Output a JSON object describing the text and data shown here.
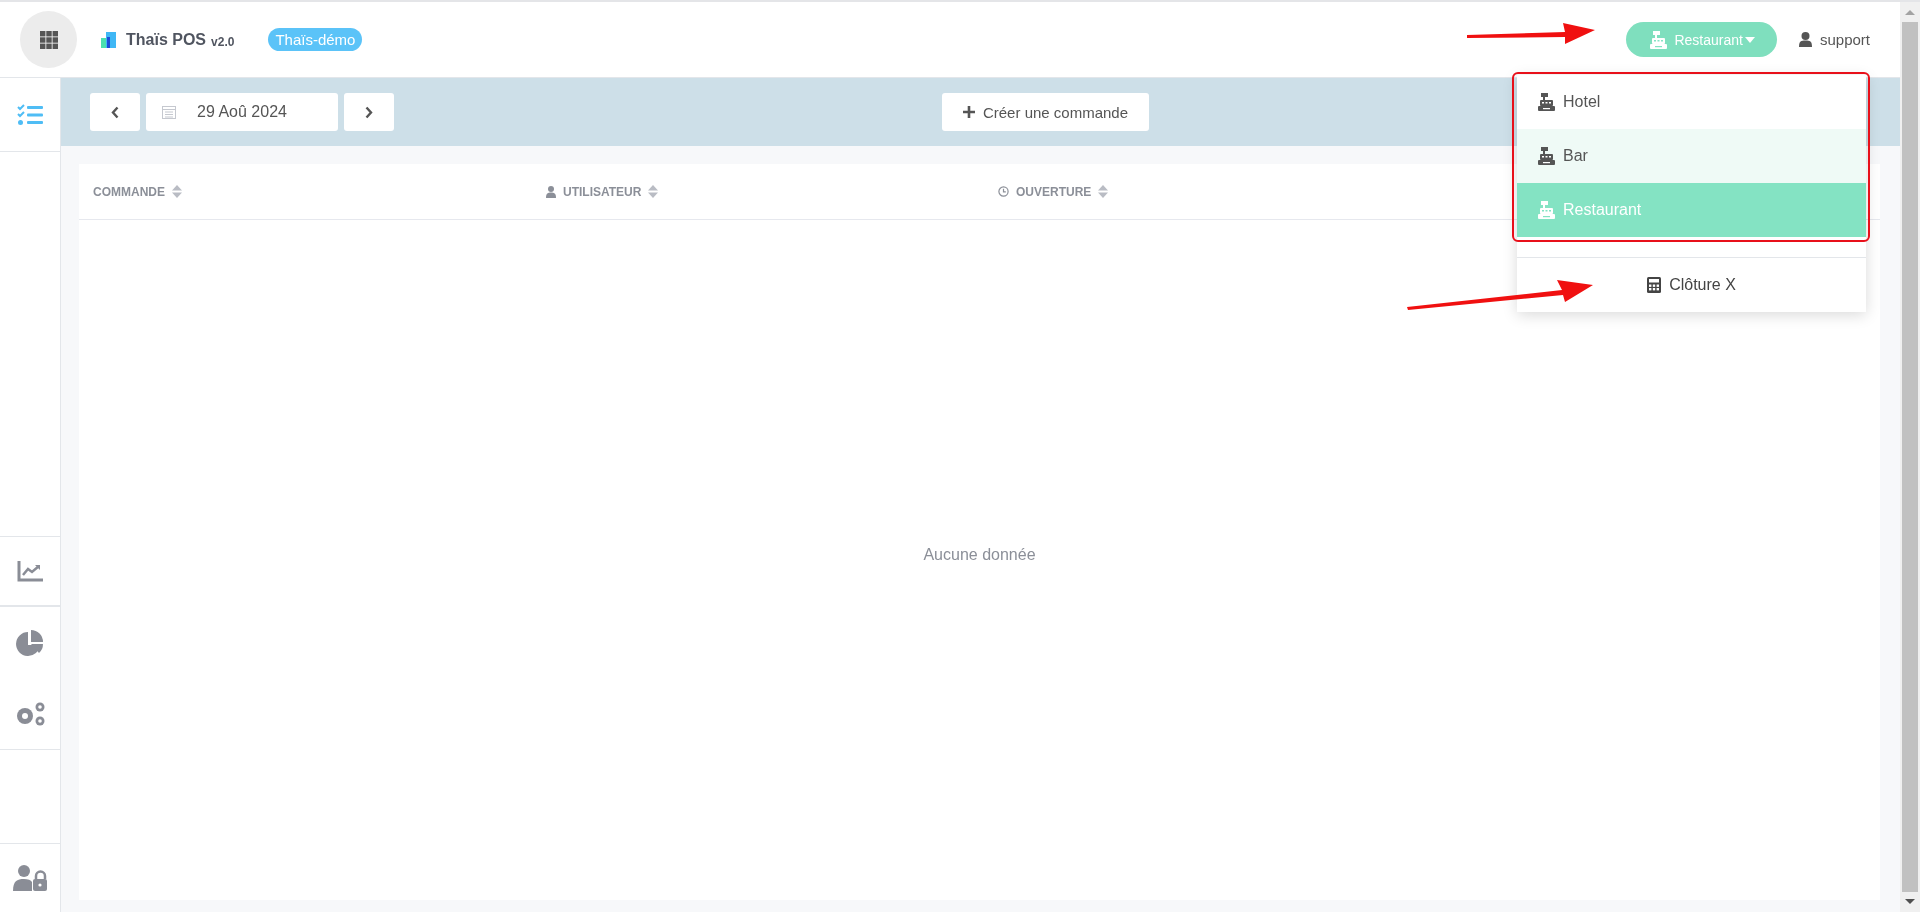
{
  "header": {
    "app_title": "Thaïs POS",
    "version": "v2.0",
    "account_badge": "Thaïs-démo",
    "site_button": {
      "label": "Restaurant",
      "expanded": true
    },
    "user": "support"
  },
  "sidebar": {
    "items": [
      {
        "selected": true
      },
      {
        "selected": false
      },
      {
        "selected": false
      },
      {
        "selected": false
      },
      {
        "selected": false
      }
    ]
  },
  "toolbar": {
    "date": "29 Aoû 2024",
    "create_button": "Créer une commande"
  },
  "table": {
    "columns": [
      "COMMANDE",
      "UTILISATEUR",
      "OUVERTURE"
    ],
    "empty_text": "Aucune donnée"
  },
  "site_menu": {
    "items": [
      {
        "label": "Hotel",
        "selected": false,
        "hovered": false
      },
      {
        "label": "Bar",
        "selected": false,
        "hovered": true
      },
      {
        "label": "Restaurant",
        "selected": true,
        "hovered": false
      }
    ],
    "action": "Clôture X"
  }
}
